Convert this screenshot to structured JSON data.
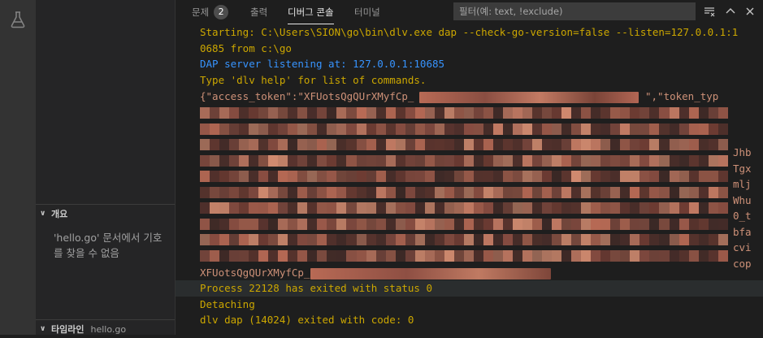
{
  "sidebar": {
    "outline": {
      "title": "개요",
      "empty_message": "'hello.go' 문서에서 기호를 찾을 수 없음"
    },
    "timeline": {
      "title": "타임라인",
      "file": "hello.go"
    }
  },
  "panel": {
    "tabs": [
      {
        "label": "문제",
        "badge": "2"
      },
      {
        "label": "출력"
      },
      {
        "label": "디버그 콘솔"
      },
      {
        "label": "터미널"
      }
    ],
    "filter_placeholder": "필터(예: text, !exclude)"
  },
  "console": {
    "lines": [
      {
        "text": "Starting: C:\\Users\\SION\\go\\bin\\dlv.exe dap --check-go-version=false --listen=127.0.0.1:1",
        "color": "#cca700"
      },
      {
        "text": "0685 from c:\\go",
        "color": "#cca700"
      },
      {
        "text": "DAP server listening at: 127.0.0.1:10685",
        "color": "#3794ff"
      },
      {
        "text": "Type 'dlv help' for list of commands.",
        "color": "#cca700"
      },
      {
        "text": "{\"access_token\":\"XFUotsQgQUrXMyfCp_",
        "color": "#ce9178"
      },
      {
        "text": "\",\"token_typ",
        "color": "#ce9178"
      }
    ],
    "right_fragments": [
      "Jhb",
      "Tgx",
      "mlj",
      "Whu",
      "0_t",
      "bfa",
      "cvi",
      "cop"
    ],
    "token_tail": "XFUotsQgQUrXMyfCp_",
    "after_lines": [
      {
        "text": "Process 22128 has exited with status 0",
        "color": "#cca700"
      },
      {
        "text": "Detaching",
        "color": "#cca700"
      },
      {
        "text": "dlv dap (14024) exited with code: 0",
        "color": "#cca700"
      }
    ]
  },
  "colors": {
    "yellow": "#cca700",
    "blue": "#3794ff",
    "string": "#ce9178",
    "background": "#1e1e1e"
  }
}
